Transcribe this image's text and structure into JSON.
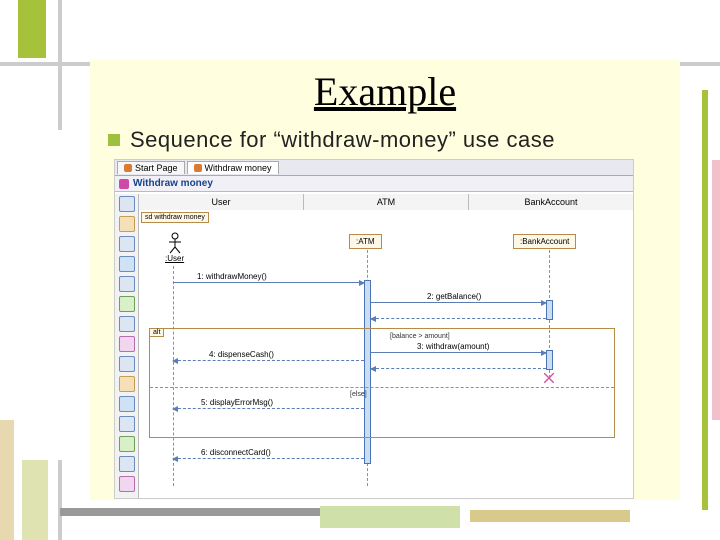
{
  "slide": {
    "title": "Example",
    "bullet": "Sequence for “withdraw-money” use case"
  },
  "tool": {
    "tabs": [
      {
        "label": "Start Page"
      },
      {
        "label": "Withdraw money"
      }
    ],
    "active_tab": 1,
    "diagram_header": "Withdraw money",
    "column_headers": [
      "User",
      "ATM",
      "BankAccount"
    ],
    "frame_name": "sd withdraw money",
    "actors": {
      "user_label": ":User",
      "atm_label": ":ATM",
      "bank_label": ":BankAccount"
    },
    "messages": {
      "m1": "1: withdrawMoney()",
      "m2": "2: getBalance()",
      "m3": "3: withdraw(amount)",
      "m4": "4: dispenseCash()",
      "m5": "5: displayErrorMsg()",
      "m6": "6: disconnectCard()"
    },
    "alt": {
      "label": "alt",
      "guard_true": "[balance > amount]",
      "guard_else": "[else]"
    }
  }
}
